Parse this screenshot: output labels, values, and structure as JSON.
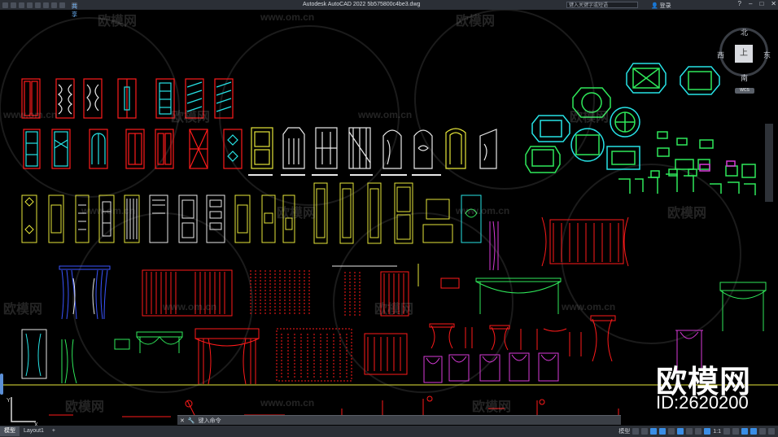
{
  "titlebar": {
    "share_label": "共享",
    "app_title": "Autodesk AutoCAD 2022    5b575800c4be3.dwg",
    "search_placeholder": "键入关键字或短语",
    "login_label": "登录"
  },
  "viewcube": {
    "north": "北",
    "south": "南",
    "east": "东",
    "west": "西",
    "face": "上",
    "wcs_label": "WCS"
  },
  "watermarks": {
    "brand": "欧模网",
    "url": "www.om.cn"
  },
  "overlay": {
    "brand": "欧模网",
    "id": "ID:2620200"
  },
  "command_line": {
    "prompt": "键入命令"
  },
  "status": {
    "tab_model": "模型",
    "tab_layout": "Layout1",
    "add_tab": "+",
    "model_label": "模型",
    "scale": "1:1"
  },
  "colors": {
    "red": "#ff1a1a",
    "cyan": "#27e3e6",
    "yellow": "#e6e63a",
    "green": "#2fe85a",
    "magenta": "#d83ad8",
    "blue": "#3a55ff",
    "white": "#e8e8e8"
  }
}
